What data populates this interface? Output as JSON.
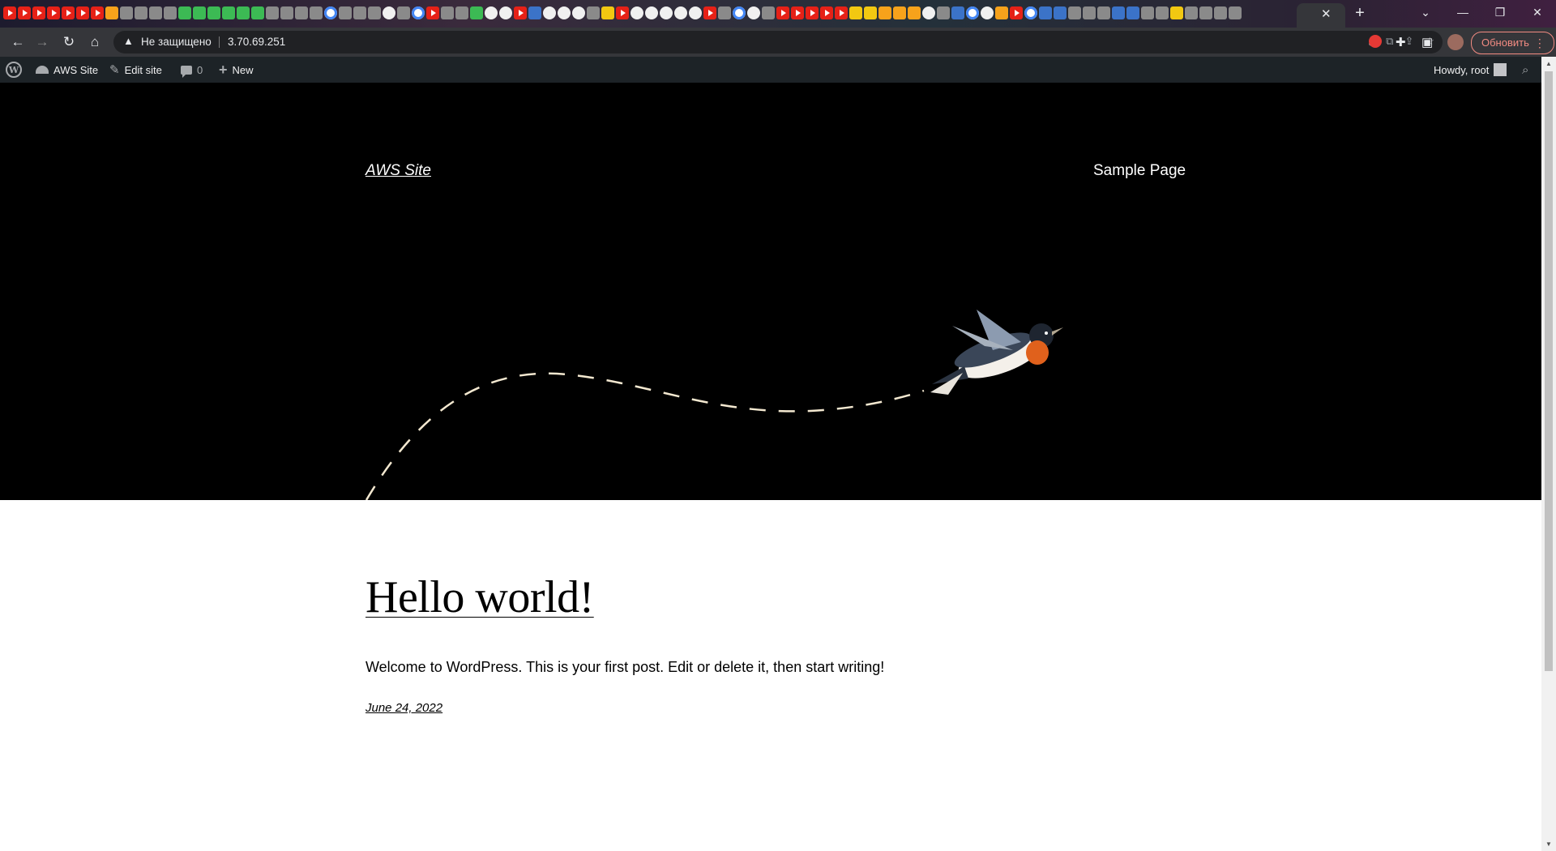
{
  "browser": {
    "security_label": "Не защищено",
    "url": "3.70.69.251",
    "update_button": "Обновить",
    "tab_close": "✕",
    "new_tab": "+",
    "window_controls": [
      "⌄",
      "—",
      "❐",
      "✕"
    ]
  },
  "admin_bar": {
    "site_name": "AWS Site",
    "edit_site": "Edit site",
    "comments_count": "0",
    "new_label": "New",
    "howdy": "Howdy, root"
  },
  "site": {
    "title": "AWS Site",
    "nav_link": "Sample Page"
  },
  "post": {
    "title": "Hello world!",
    "excerpt": "Welcome to WordPress. This is your first post. Edit or delete it, then start writing!",
    "date": "June 24, 2022"
  },
  "colors": {
    "hero_bg": "#000000",
    "admin_bar_bg": "#1d2327",
    "chrome_toolbar": "#35363a",
    "update_accent": "#f28b82"
  }
}
